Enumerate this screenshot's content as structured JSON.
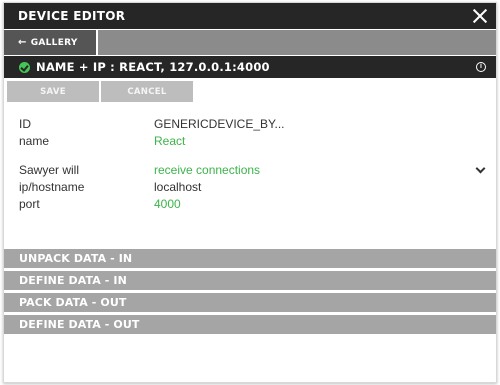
{
  "window": {
    "title": "DEVICE EDITOR"
  },
  "gallery": {
    "label": "GALLERY",
    "arrow": "←"
  },
  "device": {
    "title": "NAME + IP : REACT, 127.0.0.1:4000",
    "info": "i"
  },
  "actions": {
    "save_label": "SAVE",
    "cancel_label": "CANCEL"
  },
  "fields": {
    "id": {
      "label": "ID",
      "value": "GENERICDEVICE_BY..."
    },
    "name": {
      "label": "name",
      "value": "React"
    },
    "sawyer": {
      "label": "Sawyer will",
      "value": "receive connections"
    },
    "ip": {
      "label": "ip/hostname",
      "value": "localhost"
    },
    "port": {
      "label": "port",
      "value": "4000"
    }
  },
  "sections": [
    {
      "label": "UNPACK DATA - IN"
    },
    {
      "label": "DEFINE DATA - IN"
    },
    {
      "label": "PACK DATA - OUT"
    },
    {
      "label": "DEFINE DATA - OUT"
    }
  ],
  "colors": {
    "accent_green": "#3cb44b",
    "dark": "#262626",
    "section_gray": "#a5a5a5"
  }
}
